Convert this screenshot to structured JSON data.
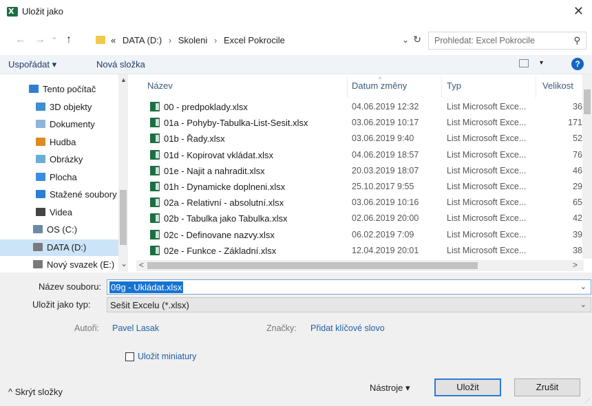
{
  "window": {
    "title": "Uložit jako",
    "close_glyph": "✕"
  },
  "address": {
    "back": "←",
    "forward": "→",
    "recent": "⌄",
    "up": "↑",
    "prefix": "«",
    "crumbs": [
      "DATA (D:)",
      "Skoleni",
      "Excel Pokrocile"
    ],
    "sep": "›",
    "dropdown": "⌄",
    "refresh": "↻"
  },
  "search": {
    "placeholder": "Prohledat: Excel Pokrocile",
    "icon": "⚲"
  },
  "commandbar": {
    "organize": "Uspořádat ▾",
    "new_folder": "Nová složka",
    "help": "?",
    "view_chev": "▾"
  },
  "nav": {
    "items": [
      {
        "label": "Tento počítač",
        "icon": "pc-icon",
        "color": "#2f7fd0"
      },
      {
        "label": "3D objekty",
        "icon": "3d-objects-icon",
        "color": "#3e8ed0"
      },
      {
        "label": "Dokumenty",
        "icon": "documents-icon",
        "color": "#8fb5d9"
      },
      {
        "label": "Hudba",
        "icon": "music-icon",
        "color": "#e08a1e"
      },
      {
        "label": "Obrázky",
        "icon": "pictures-icon",
        "color": "#6aaed6"
      },
      {
        "label": "Plocha",
        "icon": "desktop-icon",
        "color": "#3a8ee0"
      },
      {
        "label": "Stažené soubory",
        "icon": "downloads-icon",
        "color": "#2c7ed6"
      },
      {
        "label": "Videa",
        "icon": "videos-icon",
        "color": "#444444"
      },
      {
        "label": "OS (C:)",
        "icon": "drive-c-icon",
        "color": "#6a8aa8"
      },
      {
        "label": "DATA (D:)",
        "icon": "drive-d-icon",
        "color": "#7a7a7a"
      },
      {
        "label": "Nový svazek (E:)",
        "icon": "drive-e-icon",
        "color": "#7a7a7a"
      }
    ],
    "selected_index": 9,
    "scroll_up": "▲",
    "scroll_down": "⌄"
  },
  "list": {
    "columns": {
      "name": "Název",
      "date": "Datum změny",
      "type": "Typ",
      "size": "Velikost"
    },
    "sort_caret": "^",
    "rows": [
      {
        "name": "00 - predpoklady.xlsx",
        "date": "04.06.2019 12:32",
        "type": "List Microsoft Exce...",
        "size": "36"
      },
      {
        "name": "01a - Pohyby-Tabulka-List-Sesit.xlsx",
        "date": "03.06.2019 10:17",
        "type": "List Microsoft Exce...",
        "size": "171"
      },
      {
        "name": "01b - Řady.xlsx",
        "date": "03.06.2019 9:40",
        "type": "List Microsoft Exce...",
        "size": "52"
      },
      {
        "name": "01d - Kopirovat vkládat.xlsx",
        "date": "04.06.2019 18:57",
        "type": "List Microsoft Exce...",
        "size": "76"
      },
      {
        "name": "01e - Najit a nahradit.xlsx",
        "date": "20.03.2019 18:07",
        "type": "List Microsoft Exce...",
        "size": "46"
      },
      {
        "name": "01h - Dynamicke doplneni.xlsx",
        "date": "25.10.2017 9:55",
        "type": "List Microsoft Exce...",
        "size": "29"
      },
      {
        "name": "02a - Relativní - absolutní.xlsx",
        "date": "03.06.2019 10:16",
        "type": "List Microsoft Exce...",
        "size": "65"
      },
      {
        "name": "02b - Tabulka jako Tabulka.xlsx",
        "date": "02.06.2019 20:00",
        "type": "List Microsoft Exce...",
        "size": "42"
      },
      {
        "name": "02c - Definovane nazvy.xlsx",
        "date": "06.02.2019 7:09",
        "type": "List Microsoft Exce...",
        "size": "39"
      },
      {
        "name": "02e - Funkce - Základní.xlsx",
        "date": "12.04.2019 20:01",
        "type": "List Microsoft Exce...",
        "size": "38"
      }
    ],
    "hscroll_left": "<",
    "hscroll_right": ">"
  },
  "form": {
    "filename_label": "Název souboru:",
    "filename_value": "09g - Ukládat.xlsx",
    "savetype_label": "Uložit jako typ:",
    "savetype_value": "Sešit Excelu (*.xlsx)",
    "authors_label": "Autoři:",
    "authors_value": "Pavel Lasak",
    "tags_label": "Značky:",
    "tags_value": "Přidat klíčové slovo",
    "thumbnail_label": "Uložit miniatury",
    "dd_chev": "⌄"
  },
  "footer": {
    "hide_folders": "^ Skrýt složky",
    "tools": "Nástroje  ▾",
    "save": "Uložit",
    "cancel": "Zrušit",
    "grip": "⋰"
  }
}
